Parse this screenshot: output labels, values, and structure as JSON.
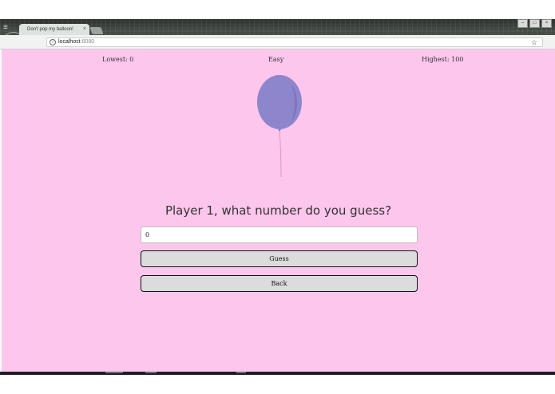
{
  "browser": {
    "tab_title": "Don't pop my balloon!",
    "tab_close": "×",
    "url_host": "localhost",
    "url_port": ":8080",
    "star": "☆",
    "window_buttons": [
      "–",
      "□",
      "×"
    ]
  },
  "header": {
    "lowest": "Lowest: 0",
    "difficulty": "Easy",
    "highest": "Highest: 100"
  },
  "balloon": {
    "color": "#8e86cc",
    "shade_color": "#7d75bd"
  },
  "game": {
    "question": "Player 1, what number do you guess?",
    "input_value": "0",
    "guess_label": "Guess",
    "back_label": "Back"
  },
  "colors": {
    "page_background": "#fdc6ec",
    "button_background": "#dcdcdc"
  }
}
